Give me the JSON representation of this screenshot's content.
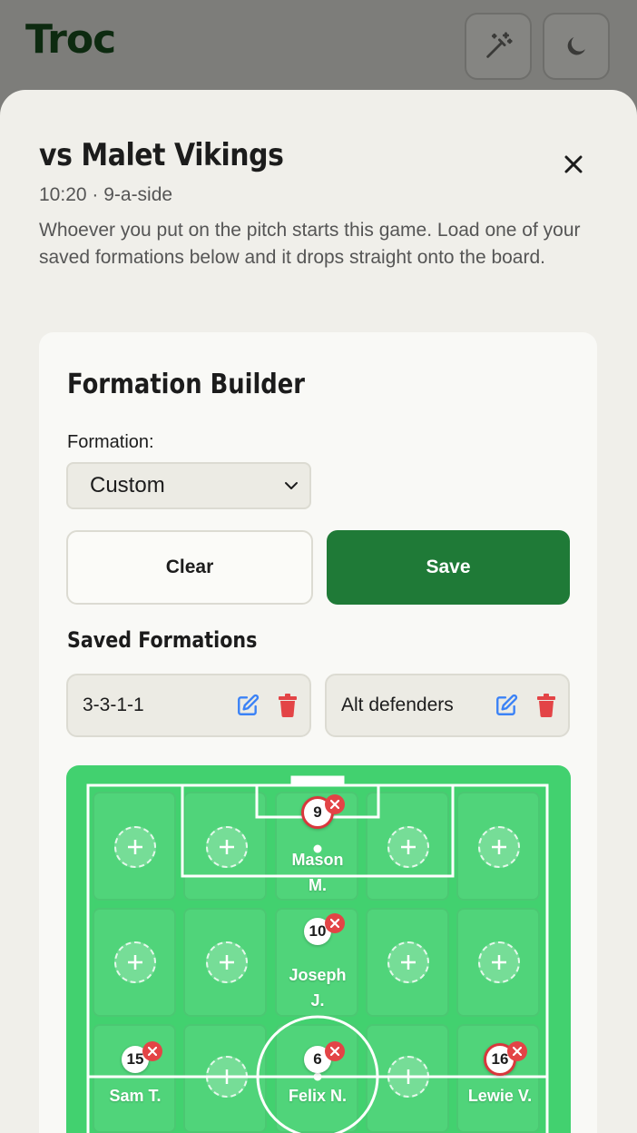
{
  "header": {
    "logo": "Troc"
  },
  "modal": {
    "title": "vs Malet Vikings",
    "subtitle": "10:20 · 9-a-side",
    "description": "Whoever you put on the pitch starts this game. Load one of your saved formations below and it drops straight onto the board."
  },
  "builder": {
    "title": "Formation Builder",
    "formation_label": "Formation:",
    "formation_value": "Custom",
    "clear_label": "Clear",
    "save_label": "Save",
    "saved_title": "Saved Formations",
    "saved": [
      {
        "name": "3-3-1-1"
      },
      {
        "name": "Alt defenders"
      }
    ]
  },
  "pitch": {
    "players": [
      {
        "number": "9",
        "name": "Mason M."
      },
      {
        "number": "10",
        "name": "Joseph J."
      },
      {
        "number": "15",
        "name": "Sam T."
      },
      {
        "number": "6",
        "name": "Felix N."
      },
      {
        "number": "16",
        "name": "Lewie V."
      }
    ]
  },
  "colors": {
    "primary": "#1f7a37",
    "pitch": "#42d16f",
    "danger": "#e34446",
    "edit": "#3b82f6"
  }
}
